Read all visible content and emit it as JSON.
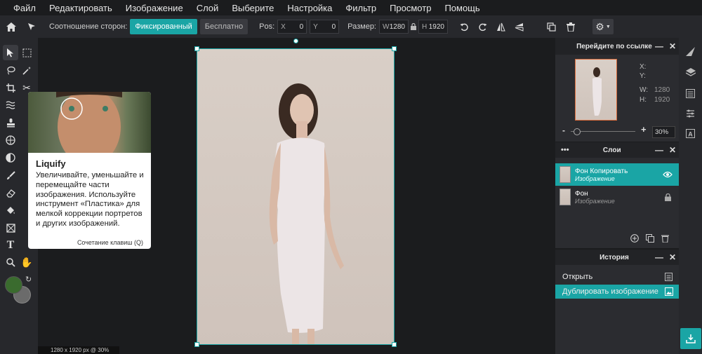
{
  "menu": [
    "Файл",
    "Редактировать",
    "Изображение",
    "Слой",
    "Выберите",
    "Настройка",
    "Фильтр",
    "Просмотр",
    "Помощь"
  ],
  "options": {
    "aspect_label": "Соотношение сторон:",
    "fixed_label": "Фиксированный",
    "free_label": "Бесплатно",
    "pos_label": "Pos:",
    "x_key": "X",
    "x_value": "0",
    "y_key": "Y",
    "y_value": "0",
    "size_label": "Размер:",
    "w_key": "W",
    "w_value": "1280",
    "h_key": "H",
    "h_value": "1920"
  },
  "tooltip": {
    "title": "Liquify",
    "description": "Увеличивайте, уменьшайте и перемещайте части изображения. Используйте инструмент «Пластика» для мелкой коррекции портретов и других изображений.",
    "shortcut": "Сочетание клавиш (Q)"
  },
  "status": "1280 x 1920 px @ 30%",
  "navigator": {
    "title": "Перейдите по ссылке",
    "x_label": "X:",
    "y_label": "Y:",
    "w_label": "W:",
    "w_value": "1280",
    "h_label": "H:",
    "h_value": "1920",
    "zoom_minus": "-",
    "zoom_plus": "+",
    "zoom_value": "30%",
    "zoom_level": 0.1
  },
  "layers": {
    "title": "Слои",
    "items": [
      {
        "name": "Фон Копировать",
        "type": "Изображение",
        "active": true
      },
      {
        "name": "Фон",
        "type": "Изображение",
        "active": false
      }
    ]
  },
  "history": {
    "title": "История",
    "items": [
      {
        "label": "Открыть",
        "active": false
      },
      {
        "label": "Дублировать изображение",
        "active": true
      }
    ]
  },
  "colors": {
    "accent": "#1aa5a5",
    "primary": "#3a6b2e",
    "secondary": "#6b6b6b",
    "panel_bg": "#2b2c30",
    "app_bg": "#1b1c1e"
  }
}
